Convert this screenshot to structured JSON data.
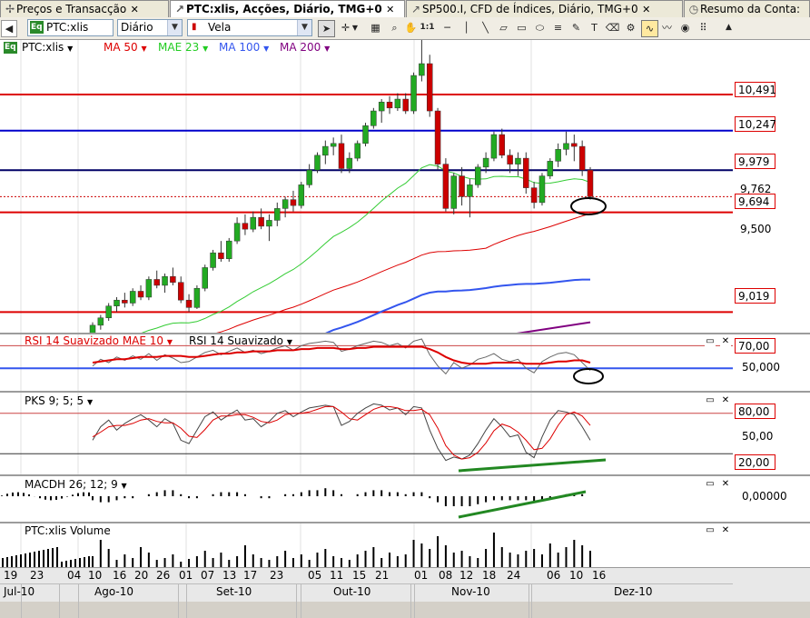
{
  "tabs": [
    {
      "label": "Preços e Transacção",
      "icon": "pin-icon"
    },
    {
      "label": "PTC:xlis, Acções, Diário, TMG+0",
      "icon": "chart-icon"
    },
    {
      "label": "SP500.I, CFD de Índices, Diário, TMG+0",
      "icon": "chart-icon"
    },
    {
      "label": "Resumo da Conta:",
      "icon": "clock-icon"
    }
  ],
  "toolbar": {
    "symbol": "PTC:xlis",
    "eq_badge": "Eq",
    "period": "Diário",
    "chart_type": "Vela",
    "ratio_button": "1:1"
  },
  "price_pane": {
    "title": "PTC:xlis",
    "eq_badge": "Eq",
    "indicators": [
      {
        "label": "MA 50",
        "color": "#dd0000"
      },
      {
        "label": "MAE 23",
        "color": "#22cc22"
      },
      {
        "label": "MA 100",
        "color": "#3355ee"
      },
      {
        "label": "MA 200",
        "color": "#800080"
      }
    ],
    "y_ticks": [
      "9,500"
    ],
    "hlines": [
      {
        "label": "10,491",
        "value": 10.491,
        "color": "#dd0000"
      },
      {
        "label": "10,247",
        "value": 10.247,
        "color": "#0000cc"
      },
      {
        "label": "9,979",
        "value": 9.979,
        "color": "#000066"
      },
      {
        "label": "9,694",
        "value": 9.694,
        "color": "#dd0000"
      },
      {
        "label": "9,019",
        "value": 9.019,
        "color": "#dd0000"
      }
    ],
    "last_price_label": "9,762",
    "y_min": 8.88,
    "y_max": 10.86
  },
  "rsi_pane": {
    "title_a": "RSI 14 Suavizado MAE 10",
    "title_b": "RSI 14 Suavizado",
    "labels": [
      "70,00",
      "50,000"
    ]
  },
  "pks_pane": {
    "title": "PKS 9; 5; 5",
    "labels": [
      "80,00",
      "50,00",
      "20,00"
    ]
  },
  "macd_pane": {
    "title": "MACDH 26; 12; 9",
    "label": "0,00000"
  },
  "vol_pane": {
    "title": "PTC:xlis Volume"
  },
  "x_axis": {
    "days": [
      "19",
      "23",
      "04",
      "10",
      "16",
      "20",
      "26",
      "01",
      "07",
      "13",
      "17",
      "23",
      "05",
      "11",
      "15",
      "21",
      "01",
      "08",
      "12",
      "18",
      "24",
      "06",
      "10",
      "16"
    ],
    "months": [
      "Jul-10",
      "Ago-10",
      "Set-10",
      "Out-10",
      "Nov-10",
      "Dez-10"
    ]
  },
  "chart_data": {
    "type": "candlestick",
    "ohlc": [
      [
        8.85,
        8.95,
        8.82,
        8.93
      ],
      [
        8.93,
        9.0,
        8.9,
        8.98
      ],
      [
        8.98,
        9.08,
        8.96,
        9.06
      ],
      [
        9.06,
        9.12,
        9.02,
        9.1
      ],
      [
        9.1,
        9.15,
        9.05,
        9.08
      ],
      [
        9.08,
        9.18,
        9.06,
        9.16
      ],
      [
        9.16,
        9.2,
        9.1,
        9.12
      ],
      [
        9.12,
        9.26,
        9.1,
        9.24
      ],
      [
        9.24,
        9.3,
        9.18,
        9.2
      ],
      [
        9.2,
        9.28,
        9.15,
        9.26
      ],
      [
        9.26,
        9.32,
        9.2,
        9.22
      ],
      [
        9.22,
        9.26,
        9.08,
        9.1
      ],
      [
        9.1,
        9.14,
        9.02,
        9.05
      ],
      [
        9.05,
        9.2,
        9.04,
        9.18
      ],
      [
        9.18,
        9.34,
        9.16,
        9.32
      ],
      [
        9.32,
        9.44,
        9.3,
        9.42
      ],
      [
        9.42,
        9.5,
        9.36,
        9.38
      ],
      [
        9.38,
        9.52,
        9.36,
        9.5
      ],
      [
        9.5,
        9.66,
        9.48,
        9.62
      ],
      [
        9.62,
        9.68,
        9.54,
        9.58
      ],
      [
        9.58,
        9.7,
        9.56,
        9.66
      ],
      [
        9.66,
        9.72,
        9.58,
        9.6
      ],
      [
        9.6,
        9.68,
        9.5,
        9.64
      ],
      [
        9.64,
        9.76,
        9.6,
        9.72
      ],
      [
        9.72,
        9.8,
        9.66,
        9.78
      ],
      [
        9.78,
        9.84,
        9.7,
        9.74
      ],
      [
        9.74,
        9.9,
        9.72,
        9.88
      ],
      [
        9.88,
        10.02,
        9.86,
        9.98
      ],
      [
        9.98,
        10.1,
        9.96,
        10.08
      ],
      [
        10.08,
        10.18,
        10.02,
        10.14
      ],
      [
        10.14,
        10.2,
        10.08,
        10.16
      ],
      [
        10.16,
        10.22,
        9.96,
        9.99
      ],
      [
        9.99,
        10.1,
        9.96,
        10.06
      ],
      [
        10.06,
        10.18,
        10.04,
        10.16
      ],
      [
        10.16,
        10.3,
        10.14,
        10.28
      ],
      [
        10.28,
        10.4,
        10.26,
        10.38
      ],
      [
        10.38,
        10.46,
        10.3,
        10.44
      ],
      [
        10.44,
        10.48,
        10.36,
        10.4
      ],
      [
        10.4,
        10.5,
        10.38,
        10.46
      ],
      [
        10.46,
        10.5,
        10.36,
        10.38
      ],
      [
        10.38,
        10.64,
        10.36,
        10.62
      ],
      [
        10.62,
        10.86,
        10.58,
        10.7
      ],
      [
        10.7,
        10.76,
        10.34,
        10.38
      ],
      [
        10.38,
        10.4,
        9.98,
        10.02
      ],
      [
        10.02,
        10.06,
        9.7,
        9.72
      ],
      [
        9.72,
        9.96,
        9.68,
        9.94
      ],
      [
        9.94,
        10.0,
        9.74,
        9.8
      ],
      [
        9.8,
        9.92,
        9.66,
        9.88
      ],
      [
        9.88,
        10.02,
        9.86,
        10.0
      ],
      [
        10.0,
        10.1,
        9.96,
        10.06
      ],
      [
        10.06,
        10.24,
        10.04,
        10.22
      ],
      [
        10.22,
        10.26,
        10.06,
        10.08
      ],
      [
        10.08,
        10.12,
        9.96,
        10.02
      ],
      [
        10.02,
        10.1,
        9.94,
        10.06
      ],
      [
        10.06,
        10.1,
        9.82,
        9.86
      ],
      [
        9.86,
        9.9,
        9.72,
        9.76
      ],
      [
        9.76,
        9.96,
        9.74,
        9.94
      ],
      [
        9.94,
        10.06,
        9.92,
        10.04
      ],
      [
        10.04,
        10.16,
        10.0,
        10.12
      ],
      [
        10.12,
        10.24,
        10.08,
        10.16
      ],
      [
        10.16,
        10.22,
        10.04,
        10.14
      ],
      [
        10.14,
        10.18,
        9.94,
        9.98
      ],
      [
        9.98,
        10.0,
        9.78,
        9.8
      ]
    ],
    "volume": [
      12,
      30,
      20,
      8,
      14,
      10,
      22,
      16,
      8,
      10,
      14,
      6,
      9,
      12,
      18,
      10,
      16,
      8,
      12,
      24,
      14,
      10,
      8,
      12,
      18,
      10,
      14,
      8,
      16,
      20,
      12,
      10,
      8,
      14,
      18,
      22,
      10,
      16,
      12,
      14,
      30,
      26,
      20,
      34,
      24,
      16,
      18,
      12,
      10,
      20,
      38,
      22,
      16,
      14,
      18,
      20,
      14,
      26,
      16,
      22,
      30,
      24,
      18
    ],
    "rsi_smooth": [
      55,
      56,
      57,
      58,
      58,
      59,
      60,
      60,
      60,
      61,
      61,
      61,
      60,
      60,
      61,
      62,
      63,
      63,
      64,
      64,
      65,
      65,
      65,
      66,
      66,
      66,
      67,
      67,
      68,
      68,
      68,
      67,
      67,
      68,
      68,
      69,
      69,
      69,
      69,
      69,
      69,
      69,
      67,
      64,
      60,
      57,
      55,
      54,
      54,
      54,
      55,
      55,
      55,
      55,
      54,
      54,
      54,
      55,
      56,
      56,
      57,
      57,
      55
    ],
    "rsi_raw": [
      52,
      58,
      55,
      60,
      57,
      61,
      58,
      63,
      57,
      62,
      59,
      55,
      56,
      60,
      64,
      66,
      62,
      65,
      68,
      64,
      66,
      63,
      65,
      68,
      70,
      66,
      70,
      72,
      73,
      74,
      73,
      65,
      67,
      70,
      72,
      74,
      73,
      70,
      72,
      68,
      74,
      76,
      62,
      52,
      45,
      55,
      50,
      53,
      58,
      60,
      63,
      58,
      56,
      58,
      50,
      46,
      56,
      60,
      63,
      64,
      62,
      55,
      48
    ],
    "pks_k": [
      40,
      60,
      70,
      55,
      65,
      72,
      78,
      70,
      60,
      72,
      65,
      40,
      35,
      55,
      75,
      82,
      70,
      78,
      85,
      70,
      72,
      60,
      68,
      80,
      84,
      75,
      82,
      88,
      90,
      92,
      90,
      62,
      68,
      80,
      88,
      94,
      92,
      85,
      88,
      78,
      90,
      88,
      55,
      28,
      10,
      15,
      12,
      18,
      35,
      55,
      72,
      60,
      45,
      48,
      22,
      14,
      45,
      70,
      84,
      82,
      78,
      60,
      40
    ],
    "pks_d": [
      45,
      52,
      60,
      62,
      62,
      65,
      70,
      72,
      68,
      66,
      66,
      58,
      46,
      44,
      56,
      70,
      76,
      76,
      78,
      78,
      74,
      68,
      66,
      70,
      78,
      80,
      80,
      82,
      86,
      90,
      90,
      82,
      72,
      70,
      78,
      86,
      90,
      90,
      88,
      84,
      84,
      86,
      78,
      58,
      32,
      18,
      12,
      14,
      22,
      36,
      54,
      64,
      60,
      52,
      40,
      26,
      28,
      42,
      62,
      78,
      82,
      76,
      62
    ],
    "macdh": [
      -0.02,
      -0.03,
      -0.03,
      -0.02,
      -0.01,
      -0.01,
      0.0,
      0.01,
      0.02,
      0.03,
      0.03,
      0.01,
      -0.01,
      -0.01,
      0.0,
      0.01,
      0.02,
      0.02,
      0.02,
      0.01,
      0.0,
      -0.01,
      -0.01,
      0.0,
      0.01,
      0.01,
      0.02,
      0.03,
      0.03,
      0.04,
      0.03,
      0.01,
      0.0,
      0.01,
      0.02,
      0.03,
      0.03,
      0.02,
      0.02,
      0.01,
      0.02,
      0.02,
      -0.01,
      -0.03,
      -0.05,
      -0.05,
      -0.05,
      -0.05,
      -0.04,
      -0.03,
      -0.02,
      -0.02,
      -0.02,
      -0.02,
      -0.02,
      -0.03,
      -0.02,
      -0.01,
      0.0,
      0.01,
      0.01,
      0.01,
      0.0
    ]
  }
}
